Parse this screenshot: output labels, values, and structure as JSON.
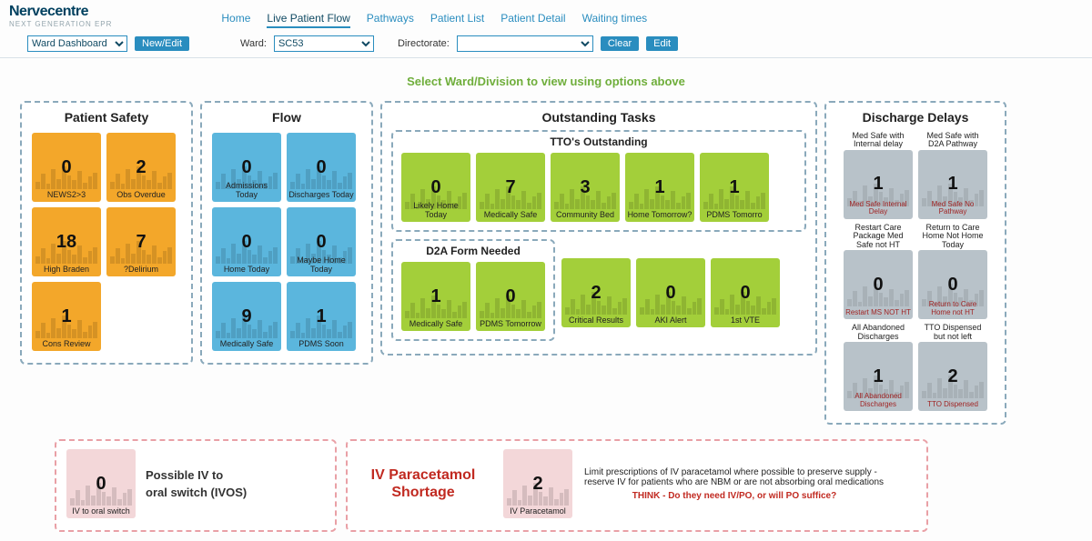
{
  "brand": {
    "name": "Nervecentre",
    "sub": "NEXT GENERATION EPR"
  },
  "nav": {
    "tabs": [
      "Home",
      "Live Patient Flow",
      "Pathways",
      "Patient List",
      "Patient Detail",
      "Waiting times"
    ],
    "active": 1
  },
  "filters": {
    "dashboard": {
      "value": "Ward Dashboard",
      "btn": "New/Edit"
    },
    "ward_lbl": "Ward:",
    "ward_value": "SC53",
    "dir_lbl": "Directorate:",
    "dir_value": "",
    "clear": "Clear",
    "edit": "Edit"
  },
  "hint": "Select Ward/Division to view using options above",
  "panels": {
    "safety": {
      "title": "Patient Safety",
      "tiles": [
        {
          "v": "0",
          "l": "NEWS2>3"
        },
        {
          "v": "2",
          "l": "Obs Overdue"
        },
        {
          "v": "18",
          "l": "High Braden"
        },
        {
          "v": "7",
          "l": "?Delirium"
        },
        {
          "v": "1",
          "l": "Cons Review"
        }
      ]
    },
    "flow": {
      "title": "Flow",
      "tiles": [
        {
          "v": "0",
          "l": "Admissions Today"
        },
        {
          "v": "0",
          "l": "Discharges Today"
        },
        {
          "v": "0",
          "l": "Home Today"
        },
        {
          "v": "0",
          "l": "Maybe Home Today"
        },
        {
          "v": "9",
          "l": "Medically Safe"
        },
        {
          "v": "1",
          "l": "PDMS Soon"
        }
      ]
    },
    "outstanding": {
      "title": "Outstanding Tasks",
      "tto": {
        "title": "TTO's Outstanding",
        "tiles": [
          {
            "v": "0",
            "l": "Likely Home Today"
          },
          {
            "v": "7",
            "l": "Medically Safe"
          },
          {
            "v": "3",
            "l": "Community Bed"
          },
          {
            "v": "1",
            "l": "Home Tomorrow?"
          },
          {
            "v": "1",
            "l": "PDMS Tomorro"
          }
        ]
      },
      "d2a": {
        "title": "D2A Form Needed",
        "tiles": [
          {
            "v": "1",
            "l": "Medically Safe"
          },
          {
            "v": "0",
            "l": "PDMS Tomorrow"
          }
        ]
      },
      "free": [
        {
          "v": "2",
          "l": "Critical Results"
        },
        {
          "v": "0",
          "l": "AKI Alert"
        },
        {
          "v": "0",
          "l": "1st VTE"
        }
      ]
    },
    "delays": {
      "title": "Discharge Delays",
      "rows": [
        [
          {
            "top": "Med Safe with Internal delay",
            "v": "1",
            "l": "Med Safe Internal Delay"
          },
          {
            "top": "Med Safe with D2A Pathway",
            "v": "1",
            "l": "Med Safe No Pathway"
          }
        ],
        [
          {
            "top": "Restart Care Package Med Safe not HT",
            "v": "0",
            "l": "Restart MS NOT HT"
          },
          {
            "top": "Return to Care Home Not Home Today",
            "v": "0",
            "l": "Return to Care Home not HT"
          }
        ],
        [
          {
            "top": "All Abandoned Discharges",
            "v": "1",
            "l": "All Abandoned Discharges"
          },
          {
            "top": "TTO Dispensed but not left",
            "v": "2",
            "l": "TTO Dispensed"
          }
        ]
      ]
    }
  },
  "ivos": {
    "tile": {
      "v": "0",
      "l": "IV to oral switch"
    },
    "msg_l1": "Possible IV to",
    "msg_l2": "oral switch (IVOS)"
  },
  "shortage": {
    "title_l1": "IV Paracetamol",
    "title_l2": "Shortage",
    "tile": {
      "v": "2",
      "l": "IV Paracetamol"
    },
    "body": "Limit prescriptions of IV paracetamol where possible to preserve supply - reserve IV for patients who are NBM or are not absorbing oral medications",
    "think": "THINK - Do they need IV/PO, or will PO suffice?"
  }
}
